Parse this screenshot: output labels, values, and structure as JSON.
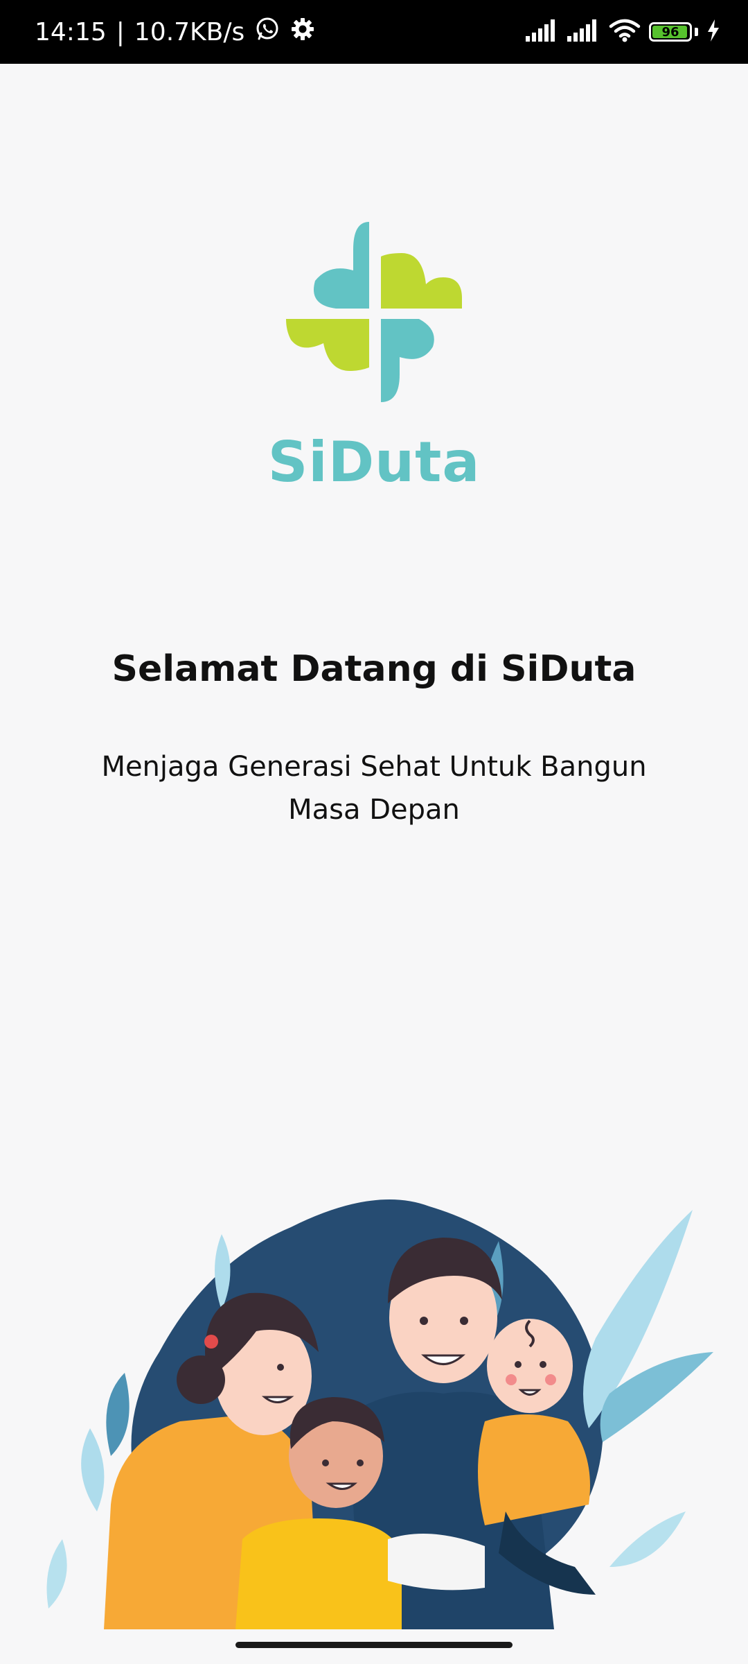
{
  "status_bar": {
    "time": "14:15",
    "separator": "|",
    "network_speed": "10.7KB/s",
    "icons": [
      "whatsapp-icon",
      "settings-gear-icon",
      "signal-icon",
      "signal-icon",
      "wifi-icon",
      "battery-icon",
      "charging-icon"
    ],
    "battery_level": "96",
    "battery_fraction": 0.96,
    "battery_color": "#57c22e"
  },
  "brand": {
    "name": "SiDuta",
    "color_teal": "#62c3c4",
    "color_lime": "#bed831"
  },
  "welcome": {
    "title": "Selamat Datang di SiDuta",
    "tagline": "Menjaga Generasi Sehat Untuk Bangun Masa Depan"
  },
  "illustration": {
    "icon": "family-illustration"
  }
}
